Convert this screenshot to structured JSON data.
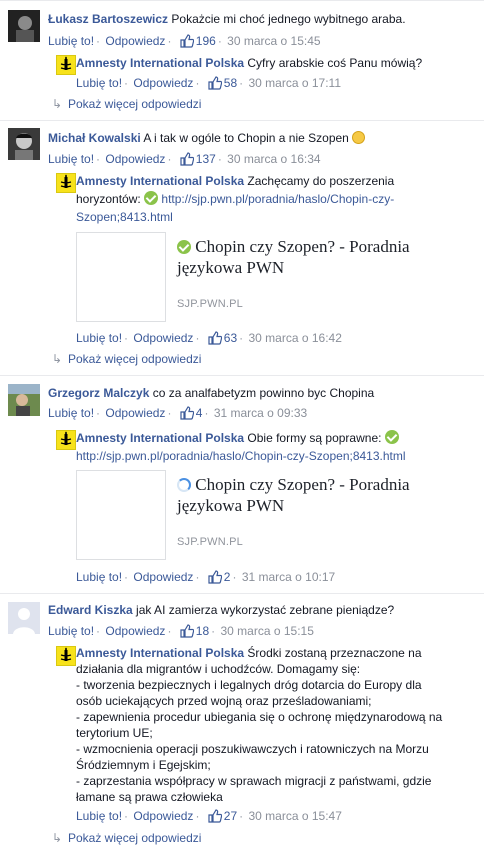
{
  "common": {
    "like_label": "Lubię to!",
    "reply_label": "Odpowiedz",
    "more_replies": "Pokaż więcej odpowiedzi"
  },
  "c1": {
    "author": "Łukasz Bartoszewicz",
    "text": "Pokażcie mi choć jednego wybitnego araba.",
    "likes": "196",
    "date": "30 marca o 15:45",
    "reply": {
      "author": "Amnesty International Polska",
      "text": "Cyfry arabskie coś Panu mówią?",
      "likes": "58",
      "date": "30 marca o 17:11"
    }
  },
  "c2": {
    "author": "Michał Kowalski",
    "text": "A i tak w ogóle to Chopin a nie Szopen",
    "likes": "137",
    "date": "30 marca o 16:34",
    "reply": {
      "author": "Amnesty International Polska",
      "text_a": "Zachęcamy do poszerzenia",
      "text_b": "horyzontów:",
      "url_a": "http://sjp.pwn.pl/poradnia/haslo/Chopin-czy-",
      "url_b": "Szopen;8413.html",
      "preview_title": "Chopin czy Szopen? - Poradnia językowa PWN",
      "preview_domain": "SJP.PWN.PL",
      "likes": "63",
      "date": "30 marca o 16:42"
    }
  },
  "c3": {
    "author": "Grzegorz Malczyk",
    "text": "co za analfabetyzm powinno byc Chopina",
    "likes": "4",
    "date": "31 marca o 09:33",
    "reply": {
      "author": "Amnesty International Polska",
      "text": "Obie formy są poprawne:",
      "url": "http://sjp.pwn.pl/poradnia/haslo/Chopin-czy-Szopen;8413.html",
      "preview_title": "Chopin czy Szopen? - Poradnia językowa PWN",
      "preview_domain": "SJP.PWN.PL",
      "likes": "2",
      "date": "31 marca o 10:17"
    }
  },
  "c4": {
    "author": "Edward Kiszka",
    "text": "jak AI zamierza wykorzystać zebrane pieniądze?",
    "likes": "18",
    "date": "30 marca o 15:15",
    "reply": {
      "author": "Amnesty International Polska",
      "lines": [
        "Środki zostaną przeznaczone na",
        "działania dla migrantów i uchodźców. Domagamy się:",
        "- tworzenia bezpiecznych i legalnych dróg dotarcia do Europy dla",
        "osób uciekających przed wojną oraz prześladowaniami;",
        "- zapewnienia procedur ubiegania się o ochronę międzynarodową na",
        "terytorium UE;",
        "- wzmocnienia operacji poszukiwawczych i ratowniczych na Morzu",
        "Śródziemnym i Egejskim;",
        "- zaprzestania współpracy w sprawach migracji z państwami, gdzie",
        "łamane są prawa człowieka"
      ],
      "likes": "27",
      "date": "30 marca o 15:47"
    }
  },
  "colors": {
    "link": "#3b5998",
    "text": "#141823",
    "meta": "#8a8f99",
    "amnesty_yellow": "#f7e21b"
  }
}
